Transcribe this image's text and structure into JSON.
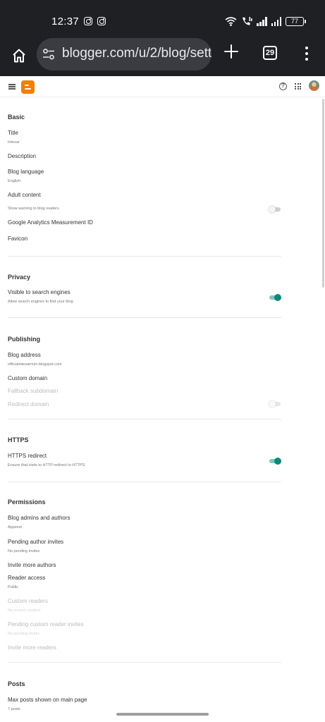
{
  "status_bar": {
    "time": "12:37",
    "notification_icons": [
      "instagram-icon",
      "instagram-icon"
    ],
    "system_icons": [
      "wifi-icon",
      "call-icon",
      "signal-icon",
      "signal-icon"
    ],
    "battery_level": "77"
  },
  "browser": {
    "url": "blogger.com/u/2/blog/sett",
    "tab_count": "29"
  },
  "header": {
    "icons": [
      "menu-icon",
      "blogger-logo",
      "help-icon",
      "apps-icon",
      "avatar"
    ]
  },
  "sections": {
    "basic": {
      "title": "Basic",
      "title_label": "Title",
      "title_value": "Intezar",
      "description_label": "Description",
      "language_label": "Blog language",
      "language_value": "English",
      "adult_label": "Adult content",
      "adult_sub": "Show warning to blog readers",
      "adult_enabled": false,
      "analytics_label": "Google Analytics Measurement ID",
      "favicon_label": "Favicon"
    },
    "privacy": {
      "title": "Privacy",
      "visible_label": "Visible to search engines",
      "visible_sub": "Allow search engines to find your blog",
      "visible_enabled": true
    },
    "publishing": {
      "title": "Publishing",
      "address_label": "Blog address",
      "address_value": "officialintezarmzn.blogspot.com",
      "custom_domain_label": "Custom domain",
      "fallback_label": "Fallback subdomain",
      "redirect_label": "Redirect domain",
      "redirect_enabled": false
    },
    "https": {
      "title": "HTTPS",
      "redirect_label": "HTTPS redirect",
      "redirect_sub": "Ensure that visits to HTTP redirect to HTTPS",
      "redirect_enabled": true
    },
    "permissions": {
      "title": "Permissions",
      "admins_label": "Blog admins and authors",
      "admins_value": "Appzest",
      "pending_label": "Pending author invites",
      "pending_value": "No pending invites",
      "invite_authors_label": "Invite more authors",
      "reader_access_label": "Reader access",
      "reader_access_value": "Public",
      "custom_readers_label": "Custom readers",
      "custom_readers_value": "No custom readers",
      "pending_readers_label": "Pending custom reader invites",
      "pending_readers_value": "No pending invites",
      "invite_readers_label": "Invite more readers"
    },
    "posts": {
      "title": "Posts",
      "max_posts_label": "Max posts shown on main page",
      "max_posts_value": "7 posts"
    }
  }
}
